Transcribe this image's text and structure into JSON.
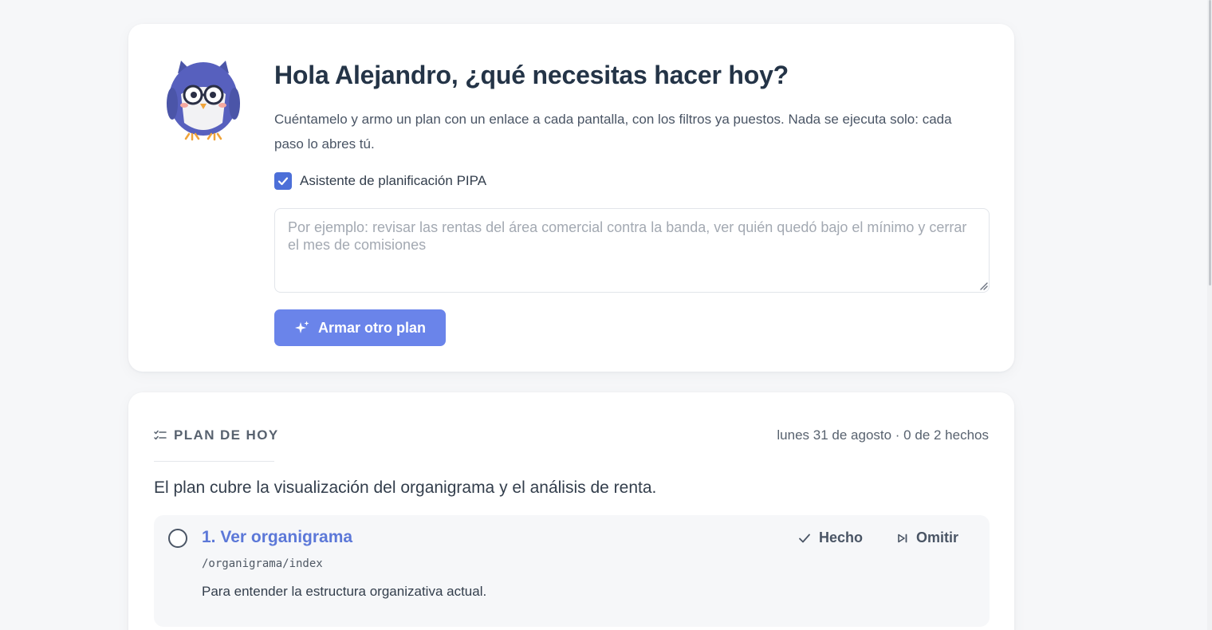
{
  "hero": {
    "title": "Hola Alejandro, ¿qué necesitas hacer hoy?",
    "description": "Cuéntamelo y armo un plan con un enlace a cada pantalla, con los filtros ya puestos. Nada se ejecuta solo: cada paso lo abres tú.",
    "assistant_label": "Asistente de planificación PIPA",
    "assistant_checked": true,
    "prompt_value": "",
    "prompt_placeholder": "Por ejemplo: revisar las rentas del área comercial contra la banda, ver quién quedó bajo el mínimo y cerrar el mes de comisiones",
    "button_label": "Armar otro plan"
  },
  "plan": {
    "title": "PLAN DE HOY",
    "meta": "lunes 31 de agosto · 0 de 2 hechos",
    "summary": "El plan cubre la visualización del organigrama y el análisis de renta.",
    "steps": [
      {
        "title": "1. Ver organigrama",
        "path": "/organigrama/index",
        "description": "Para entender la estructura organizativa actual.",
        "done_label": "Hecho",
        "skip_label": "Omitir"
      }
    ]
  },
  "colors": {
    "accent": "#6a84ea",
    "link": "#5c78d8",
    "checkbox": "#4c6fd8"
  }
}
